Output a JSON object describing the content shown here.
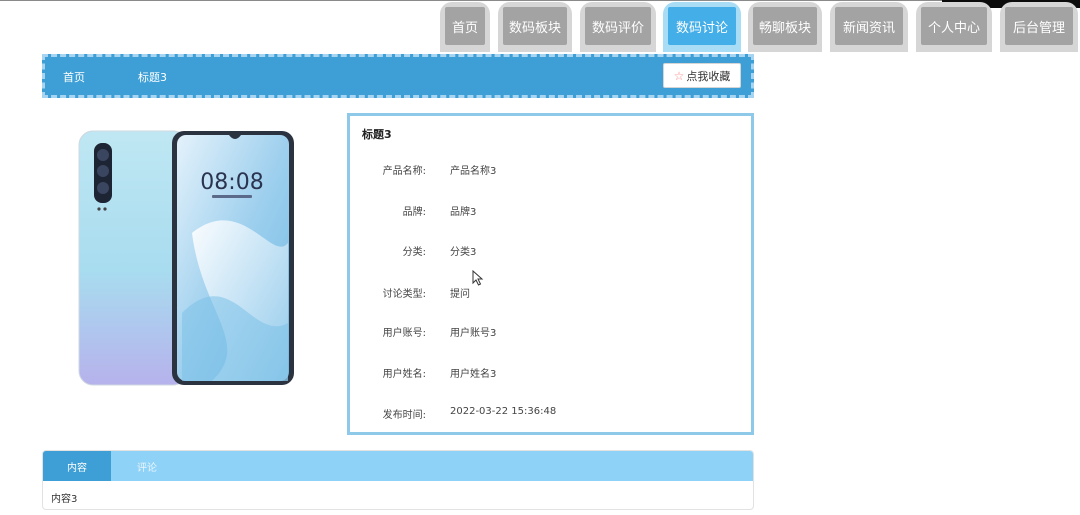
{
  "nav": {
    "tabs": [
      {
        "label": "首页",
        "active": false
      },
      {
        "label": "数码板块",
        "active": false
      },
      {
        "label": "数码评价",
        "active": false
      },
      {
        "label": "数码讨论",
        "active": true
      },
      {
        "label": "畅聊板块",
        "active": false
      },
      {
        "label": "新闻资讯",
        "active": false
      },
      {
        "label": "个人中心",
        "active": false
      },
      {
        "label": "后台管理",
        "active": false
      }
    ]
  },
  "breadcrumb": {
    "home": "首页",
    "current": "标题3",
    "favorite_label": "点我收藏",
    "favorite_icon": "star-outline-icon"
  },
  "product": {
    "image_alt": "product-phone-image",
    "lockscreen_time": "08:08"
  },
  "details": {
    "title": "标题3",
    "fields": [
      {
        "label": "产品名称:",
        "value": "产品名称3"
      },
      {
        "label": "品牌:",
        "value": "品牌3"
      },
      {
        "label": "分类:",
        "value": "分类3"
      },
      {
        "label": "讨论类型:",
        "value": "提问"
      },
      {
        "label": "用户账号:",
        "value": "用户账号3"
      },
      {
        "label": "用户姓名:",
        "value": "用户姓名3"
      },
      {
        "label": "发布时间:",
        "value": "2022-03-22 15:36:48"
      }
    ]
  },
  "content_tabs": {
    "tabs": [
      {
        "label": "内容",
        "active": true
      },
      {
        "label": "评论",
        "active": false
      }
    ],
    "body": "内容3"
  },
  "colors": {
    "accent": "#3d9fd6",
    "accent_light": "#8fd2f7",
    "tab_gray": "#a3a3a3"
  }
}
